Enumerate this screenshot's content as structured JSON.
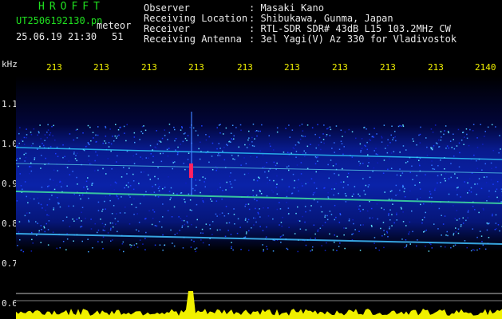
{
  "app": {
    "name": "HROFFT",
    "filename": "UT2506192130.pn",
    "type_label": "meteor",
    "timestamp": "25.06.19 21:30",
    "count": "51"
  },
  "info": {
    "labels": [
      "Observer",
      "Receiving Location",
      "Receiver",
      "Receiving Antenna"
    ],
    "values": [
      ": Masaki Kano",
      ": Shibukawa, Gunma, Japan",
      ": RTL-SDR SDR# 43dB L15 103.2MHz CW",
      ": 3el Yagi(V) Az 330 for Vladivostok"
    ]
  },
  "axes": {
    "y_unit": "kHz",
    "x_ticks": [
      "213",
      "213",
      "213",
      "213",
      "213",
      "213",
      "213",
      "213",
      "213",
      "2140"
    ],
    "y_ticks": [
      "1.1",
      "1.0",
      "0.9",
      "0.8",
      "0.7",
      "0.6"
    ]
  },
  "colors": {
    "title": "#20e020",
    "text": "#e8e8e8",
    "ticks": "#f0f000",
    "background": "#000000"
  }
}
